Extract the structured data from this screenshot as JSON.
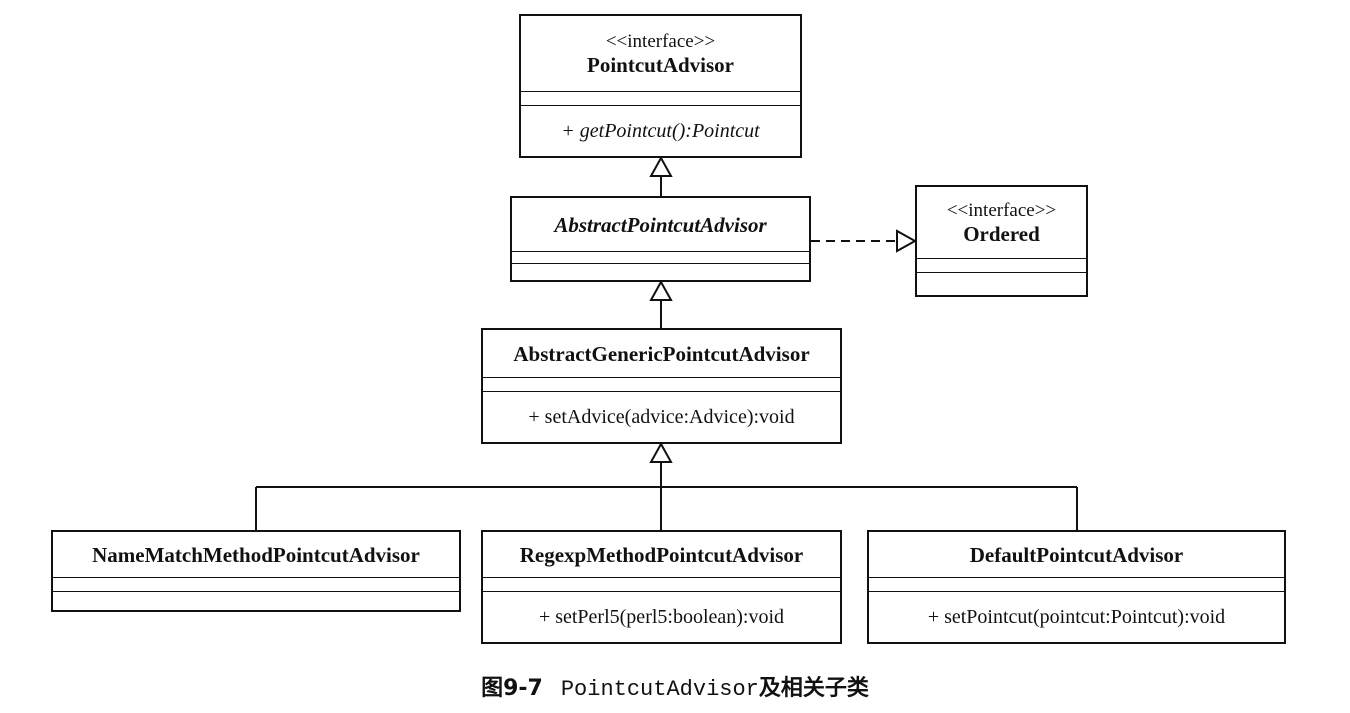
{
  "classes": {
    "pointcut_advisor": {
      "stereotype": "<<interface>>",
      "name": "PointcutAdvisor",
      "operation": "+ getPointcut():Pointcut"
    },
    "abstract_pointcut_advisor": {
      "name": "AbstractPointcutAdvisor"
    },
    "ordered": {
      "stereotype": "<<interface>>",
      "name": "Ordered"
    },
    "abstract_generic_pointcut_advisor": {
      "name": "AbstractGenericPointcutAdvisor",
      "operation": "+ setAdvice(advice:Advice):void"
    },
    "name_match_method_pointcut_advisor": {
      "name": "NameMatchMethodPointcutAdvisor"
    },
    "regexp_method_pointcut_advisor": {
      "name": "RegexpMethodPointcutAdvisor",
      "operation": "+ setPerl5(perl5:boolean):void"
    },
    "default_pointcut_advisor": {
      "name": "DefaultPointcutAdvisor",
      "operation": "+ setPointcut(pointcut:Pointcut):void"
    }
  },
  "caption": {
    "figure_number": "图9-7",
    "class_name": "PointcutAdvisor",
    "suffix": "及相关子类"
  },
  "colors": {
    "line": "#111111",
    "background": "#ffffff"
  }
}
